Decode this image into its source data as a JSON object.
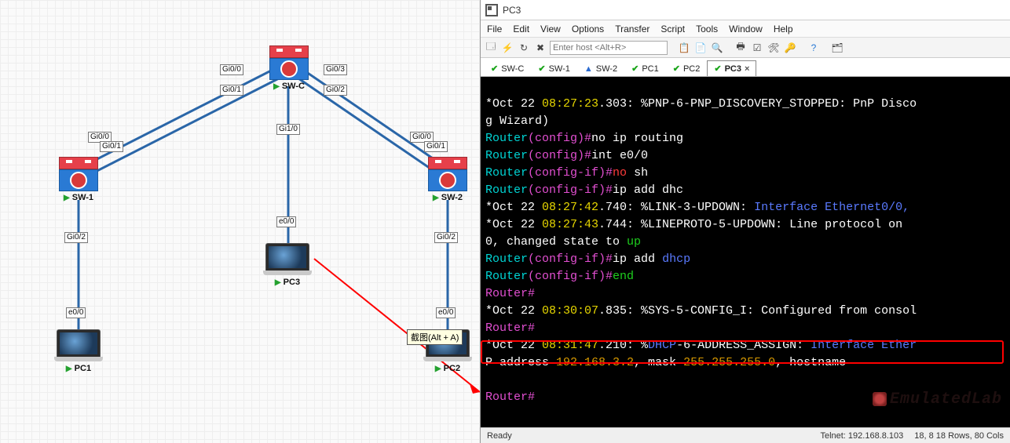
{
  "topology": {
    "nodes": {
      "swc": "SW-C",
      "sw1": "SW-1",
      "sw2": "SW-2",
      "pc1": "PC1",
      "pc2": "PC2",
      "pc3": "PC3"
    },
    "ifaces": {
      "swc_g00": "Gi0/0",
      "swc_g01": "Gi0/1",
      "swc_g02": "Gi0/2",
      "swc_g03": "Gi0/3",
      "swc_g10": "Gi1/0",
      "sw1_g00": "Gi0/0",
      "sw1_g01": "Gi0/1",
      "sw1_g02": "Gi0/2",
      "sw2_g00": "Gi0/0",
      "sw2_g01": "Gi0/1",
      "sw2_g02": "Gi0/2",
      "pc1_e00": "e0/0",
      "pc2_e00": "e0/0",
      "pc3_e00": "e0/0"
    },
    "tooltip": "截图(Alt + A)"
  },
  "window": {
    "title": "PC3",
    "menu": [
      "File",
      "Edit",
      "View",
      "Options",
      "Transfer",
      "Script",
      "Tools",
      "Window",
      "Help"
    ],
    "host_placeholder": "Enter host <Alt+R>",
    "tabs": [
      {
        "name": "SW-C",
        "status": "ok"
      },
      {
        "name": "SW-1",
        "status": "ok"
      },
      {
        "name": "SW-2",
        "status": "warn"
      },
      {
        "name": "PC1",
        "status": "ok"
      },
      {
        "name": "PC2",
        "status": "ok"
      },
      {
        "name": "PC3",
        "status": "ok",
        "active": true
      }
    ],
    "status_left": "Ready",
    "status_conn": "Telnet: 192.168.8.103",
    "status_pos": "18,   8   18 Rows, 80 Cols",
    "watermark": "EmulatedLab"
  },
  "term": {
    "l1a": "*Oct 22 ",
    "l1b": "08:27:23",
    "l1c": ".303: %PNP-6-PNP_DISCOVERY_STOPPED: PnP Disco",
    "l2": "g Wizard)",
    "l3a": "Router",
    "l3b": "(config)#",
    "l3c": "no ip routing",
    "l4a": "Router",
    "l4b": "(config)#",
    "l4c": "int e0/0",
    "l5a": "Router",
    "l5b": "(config-if)#",
    "l5c": "no ",
    "l5d": "sh",
    "l6a": "Router",
    "l6b": "(config-if)#",
    "l6c": "ip add dhc",
    "l7a": "*Oct 22 ",
    "l7b": "08:27:42",
    "l7c": ".740: %LINK-3-UPDOWN: ",
    "l7d": "Interface Ethernet0/0,",
    "l8a": "*Oct 22 ",
    "l8b": "08:27:43",
    "l8c": ".744: %LINEPROTO-5-UPDOWN: Line protocol on ",
    "l9a": "0, changed state to ",
    "l9b": "up",
    "l10a": "Router",
    "l10b": "(config-if)#",
    "l10c": "ip add ",
    "l10d": "dhcp",
    "l11a": "Router",
    "l11b": "(config-if)#",
    "l11c": "end",
    "l12": "Router#",
    "l13a": "*Oct 22 ",
    "l13b": "08:30:07",
    "l13c": ".835: %SYS-5-CONFIG_I: Configured from consol",
    "l14": "Router#",
    "l15a": "*Oct 22 ",
    "l15b": "08:31:47",
    "l15c": ".210: %",
    "l15d": "DHCP",
    "l15e": "-6-ADDRESS_ASSIGN: ",
    "l15f": "Interface Ether",
    "l16a": "P address ",
    "l16b": "192.168.3.2",
    "l16c": ", mask ",
    "l16d": "255.255.255.0",
    "l16e": ", hostname",
    "l17": "",
    "l18": "Router#"
  }
}
